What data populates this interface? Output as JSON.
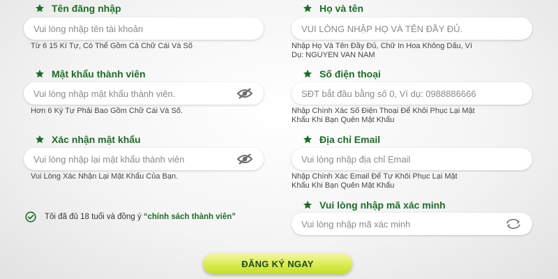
{
  "left": {
    "username": {
      "label": "Tên đăng nhập",
      "placeholder": "Vui lòng nhập tên tài khoản",
      "hint": "Từ 6 15 Kí Tự, Có Thể Gồm Cả Chữ Cái Và Số"
    },
    "password": {
      "label": "Mật khẩu thành viên",
      "placeholder": "Vui lòng nhập mật khẩu thành viên.",
      "hint": "Hơn 6 Ký Tự Phải Bao Gồm Chữ Cái Và Số."
    },
    "confirm": {
      "label": "Xác nhận mật khẩu",
      "placeholder": "Vui lòng nhập lại mật khẩu thành viên",
      "hint": "Vui Lòng Xác Nhận Lại Mật Khẩu Của Bạn."
    },
    "agree": {
      "text": "Tôi đã đủ 18 tuổi và đồng ý",
      "policy": "“chính sách thành viên”"
    }
  },
  "right": {
    "fullname": {
      "label": "Họ và tên",
      "placeholder": "VUI LÒNG NHẬP HỌ VÀ TÊN ĐẦY ĐỦ.",
      "hint_line1": "Nhập Họ Và Tên Đầy Đủ, Chữ In Hoa Không Dấu, Ví",
      "hint_line2": "Dụ: NGUYEN VAN NAM"
    },
    "phone": {
      "label": "Số điện thoại",
      "placeholder": "SĐT bắt đầu bằng số 0, Ví dụ: 0988886666",
      "hint_line1": "Nhập Chính Xác Số Điện Thoại Để Khôi Phục Lại Mật",
      "hint_line2": "Khẩu Khi Bạn Quên Mật Khẩu"
    },
    "email": {
      "label": "Địa chỉ Email",
      "placeholder": "Vui lòng nhập địa chỉ Email",
      "hint_line1": "Nhập Chính Xác Email Để Tự Khôi Phục Lại Mật",
      "hint_line2": "Khẩu Khi Bạn Quên Mật Khẩu"
    },
    "captcha": {
      "label": "Vui lòng nhập mã xác minh",
      "placeholder": "Vui lòng nhập mã xác minh"
    }
  },
  "submit_label": "ĐĂNG KÝ NGAY",
  "icons": {
    "label_marker": "star-icon",
    "password_toggle": "eye-slash-icon",
    "captcha_refresh": "refresh-icon",
    "agree_check": "check-circle-icon"
  },
  "colors": {
    "accent_green": "#1f6b2a",
    "button_yellow": "#d7ea4a",
    "hint_text": "#444444"
  }
}
